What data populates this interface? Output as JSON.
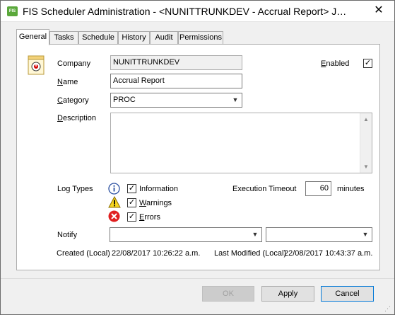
{
  "window": {
    "title": "FIS Scheduler Administration - <NUNITTRUNKDEV - Accrual Report> Jo…",
    "icon_label": "FIS",
    "close_symbol": "✕"
  },
  "tabs": [
    {
      "label": "General"
    },
    {
      "label": "Tasks"
    },
    {
      "label": "Schedule"
    },
    {
      "label": "History"
    },
    {
      "label": "Audit"
    },
    {
      "label": "Permissions"
    }
  ],
  "form": {
    "company_label": "Company",
    "company_value": "NUNITTRUNKDEV",
    "name_label": "Name",
    "name_value": "Accrual Report",
    "category_label": "Category",
    "category_value": "PROC",
    "description_label": "Description",
    "description_value": "",
    "enabled_label": "Enabled",
    "enabled_checked": true,
    "log_types_label": "Log Types",
    "log_types": [
      {
        "label": "Information",
        "checked": true,
        "icon": "info-icon"
      },
      {
        "label": "Warnings",
        "checked": true,
        "icon": "warning-icon"
      },
      {
        "label": "Errors",
        "checked": true,
        "icon": "error-icon"
      }
    ],
    "execution_timeout_label": "Execution Timeout",
    "execution_timeout_value": "60",
    "execution_timeout_unit": "minutes",
    "notify_label": "Notify",
    "notify_value_1": "",
    "notify_value_2": "",
    "created_label": "Created (Local)",
    "created_value": "22/08/2017 10:26:22 a.m.",
    "modified_label": "Last Modified (Local)",
    "modified_value": "22/08/2017 10:43:37 a.m."
  },
  "buttons": {
    "ok": "OK",
    "apply": "Apply",
    "cancel": "Cancel"
  },
  "check_mark": "✓",
  "dropdown_arrow": "▼",
  "scroll_up": "▲",
  "scroll_down": "▼"
}
